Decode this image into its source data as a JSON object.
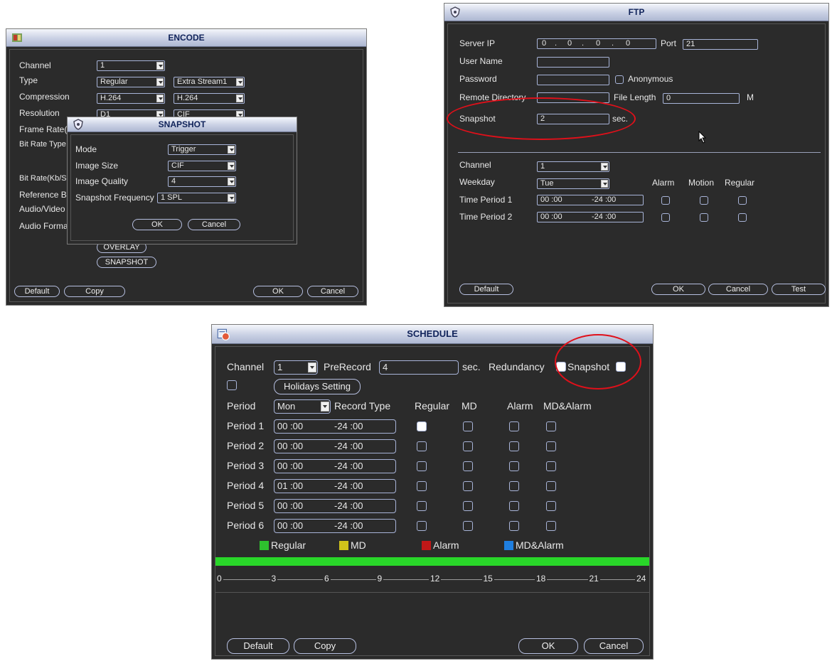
{
  "colors": {
    "regular": "#2ec12e",
    "md": "#d0c21a",
    "alarm": "#c01818",
    "md_alarm": "#1f7fe0",
    "timeline": "#29d629",
    "annotation": "#e0101a"
  },
  "encode": {
    "title": "ENCODE",
    "labels": [
      "Channel",
      "Type",
      "Compression",
      "Resolution",
      "Frame Rate(",
      "Bit Rate Type",
      "Bit Rate(Kb/S",
      "Reference B",
      "Audio/Video",
      "Audio Forma"
    ],
    "channel": "1",
    "type_main": "Regular",
    "type_extra": "Extra Stream1",
    "compression_main": "H.264",
    "compression_extra": "H.264",
    "resolution_main": "D1",
    "resolution_extra": "CIF",
    "overlay_label": "OVERLAY",
    "snapshot_label": "SNAPSHOT",
    "default_label": "Default",
    "copy_label": "Copy",
    "ok_label": "OK",
    "cancel_label": "Cancel"
  },
  "snapshot": {
    "title": "SNAPSHOT",
    "mode_label": "Mode",
    "mode": "Trigger",
    "size_label": "Image Size",
    "size": "CIF",
    "quality_label": "Image Quality",
    "quality": "4",
    "freq_label": "Snapshot Frequency",
    "freq": "1 SPL",
    "ok_label": "OK",
    "cancel_label": "Cancel"
  },
  "ftp": {
    "title": "FTP",
    "server_ip_label": "Server IP",
    "ip": [
      "0",
      "0",
      "0",
      "0"
    ],
    "port_label": "Port",
    "port": "21",
    "username_label": "User Name",
    "password_label": "Password",
    "anonymous_label": "Anonymous",
    "remote_dir_label": "Remote Directory",
    "file_length_label": "File Length",
    "file_length": "0",
    "file_length_unit": "M",
    "snapshot_label": "Snapshot",
    "snapshot": "2",
    "snapshot_unit": "sec.",
    "channel_label": "Channel",
    "channel": "1",
    "weekday_label": "Weekday",
    "weekday": "Tue",
    "alarm_label": "Alarm",
    "motion_label": "Motion",
    "regular_label": "Regular",
    "periods": [
      {
        "label": "Time Period 1",
        "start": "00 :00",
        "end": "-24 :00"
      },
      {
        "label": "Time Period 2",
        "start": "00 :00",
        "end": "-24 :00"
      }
    ],
    "default_label": "Default",
    "ok_label": "OK",
    "cancel_label": "Cancel",
    "test_label": "Test"
  },
  "schedule": {
    "title": "SCHEDULE",
    "channel_label": "Channel",
    "channel": "1",
    "prerecord_label": "PreRecord",
    "prerecord": "4",
    "prerecord_unit": "sec.",
    "redundancy_label": "Redundancy",
    "snapshot_label": "Snapshot",
    "holidays_label": "Holidays Setting",
    "period_label": "Period",
    "day": "Mon",
    "record_type_label": "Record Type",
    "col_regular": "Regular",
    "col_md": "MD",
    "col_alarm": "Alarm",
    "col_mdalarm": "MD&Alarm",
    "periods": [
      {
        "label": "Period 1",
        "start": "00 :00",
        "end": "-24 :00"
      },
      {
        "label": "Period 2",
        "start": "00 :00",
        "end": "-24 :00"
      },
      {
        "label": "Period 3",
        "start": "00 :00",
        "end": "-24 :00"
      },
      {
        "label": "Period 4",
        "start": "01 :00",
        "end": "-24 :00"
      },
      {
        "label": "Period 5",
        "start": "00 :00",
        "end": "-24 :00"
      },
      {
        "label": "Period 6",
        "start": "00 :00",
        "end": "-24 :00"
      }
    ],
    "legend": [
      "Regular",
      "MD",
      "Alarm",
      "MD&Alarm"
    ],
    "ticks": [
      "0",
      "3",
      "6",
      "9",
      "12",
      "15",
      "18",
      "21",
      "24"
    ],
    "default_label": "Default",
    "copy_label": "Copy",
    "ok_label": "OK",
    "cancel_label": "Cancel"
  }
}
